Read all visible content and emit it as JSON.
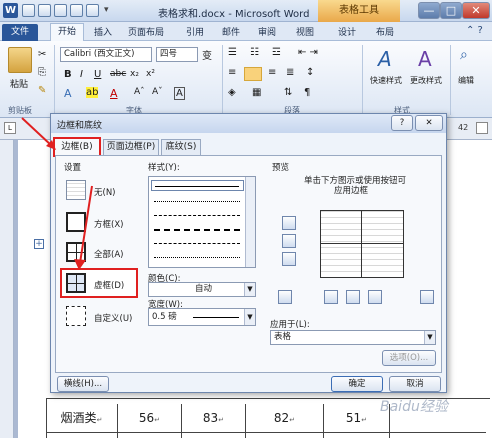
{
  "window": {
    "title": "表格求和.docx - Microsoft Word",
    "context_tab": "表格工具",
    "minimize": "—",
    "maximize": "□",
    "close": "✕"
  },
  "ribbon_tabs": [
    "文件",
    "开始",
    "插入",
    "页面布局",
    "引用",
    "邮件",
    "审阅",
    "视图",
    "设计",
    "布局"
  ],
  "ribbon": {
    "paste": "粘贴",
    "clipboard": "剪贴板",
    "font_name": "Calibri (西文正文)",
    "font_size": "四号",
    "font_group": "字体",
    "para_group": "段落",
    "styles": "样式",
    "quick_styles": "快速样式",
    "change_styles": "更改样式",
    "edit": "编辑",
    "wen": "变"
  },
  "dialog": {
    "title": "边框和底纹",
    "help": "?",
    "close": "✕",
    "tabs": [
      "边框(B)",
      "页面边框(P)",
      "底纹(S)"
    ],
    "setting_label": "设置",
    "style_label": "样式(Y):",
    "preview_label": "预览",
    "preview_hint_1": "单击下方图示或使用按钮可",
    "preview_hint_2": "应用边框",
    "settings": [
      "无(N)",
      "方框(X)",
      "全部(A)",
      "虚框(D)",
      "自定义(U)"
    ],
    "color_label": "颜色(C):",
    "color_value": "自动",
    "width_label": "宽度(W):",
    "width_value": "0.5 磅",
    "apply_label": "应用于(L):",
    "apply_value": "表格",
    "options_button": "选项(O)...",
    "hline_button": "横线(H)...",
    "ok_button": "确定",
    "cancel_button": "取消"
  },
  "table_row": {
    "label": "烟酒类",
    "values": [
      "56",
      "83",
      "82",
      "51"
    ]
  },
  "watermark": "Baidu经验",
  "ruler_number": "42"
}
